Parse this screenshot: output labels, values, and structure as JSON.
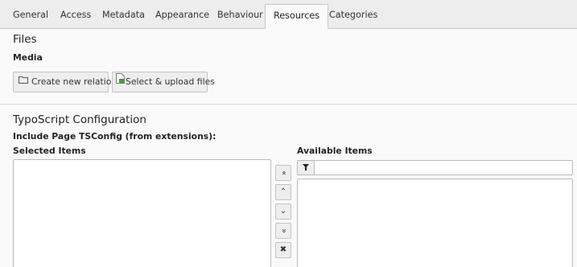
{
  "tabs": [
    {
      "label": "General",
      "active": false
    },
    {
      "label": "Access",
      "active": false
    },
    {
      "label": "Metadata",
      "active": false
    },
    {
      "label": "Appearance",
      "active": false
    },
    {
      "label": "Behaviour",
      "active": false
    },
    {
      "label": "Resources",
      "active": true
    },
    {
      "label": "Categories",
      "active": false
    }
  ],
  "files": {
    "section_title": "Files",
    "media_label": "Media",
    "create_relation_label": "Create new relation",
    "select_upload_label": "Select & upload files"
  },
  "typoscript": {
    "section_title": "TypoScript Configuration",
    "field_label": "Include Page TSConfig (from extensions):",
    "selected_label": "Selected Items",
    "available_label": "Available Items",
    "filter_value": "",
    "controls": [
      "move-to-top",
      "move-up",
      "move-down",
      "move-to-bottom",
      "remove"
    ]
  },
  "icons": {
    "move_top": "«",
    "move_up": "⌃",
    "move_down": "⌄",
    "move_bottom": "»",
    "remove": "✖",
    "filter": "filter-icon"
  },
  "colors": {
    "tabbar_bg": "#ededed",
    "panel_bg": "#fafafa",
    "button_bg": "#eeeeee",
    "border": "#c4c4c4"
  }
}
